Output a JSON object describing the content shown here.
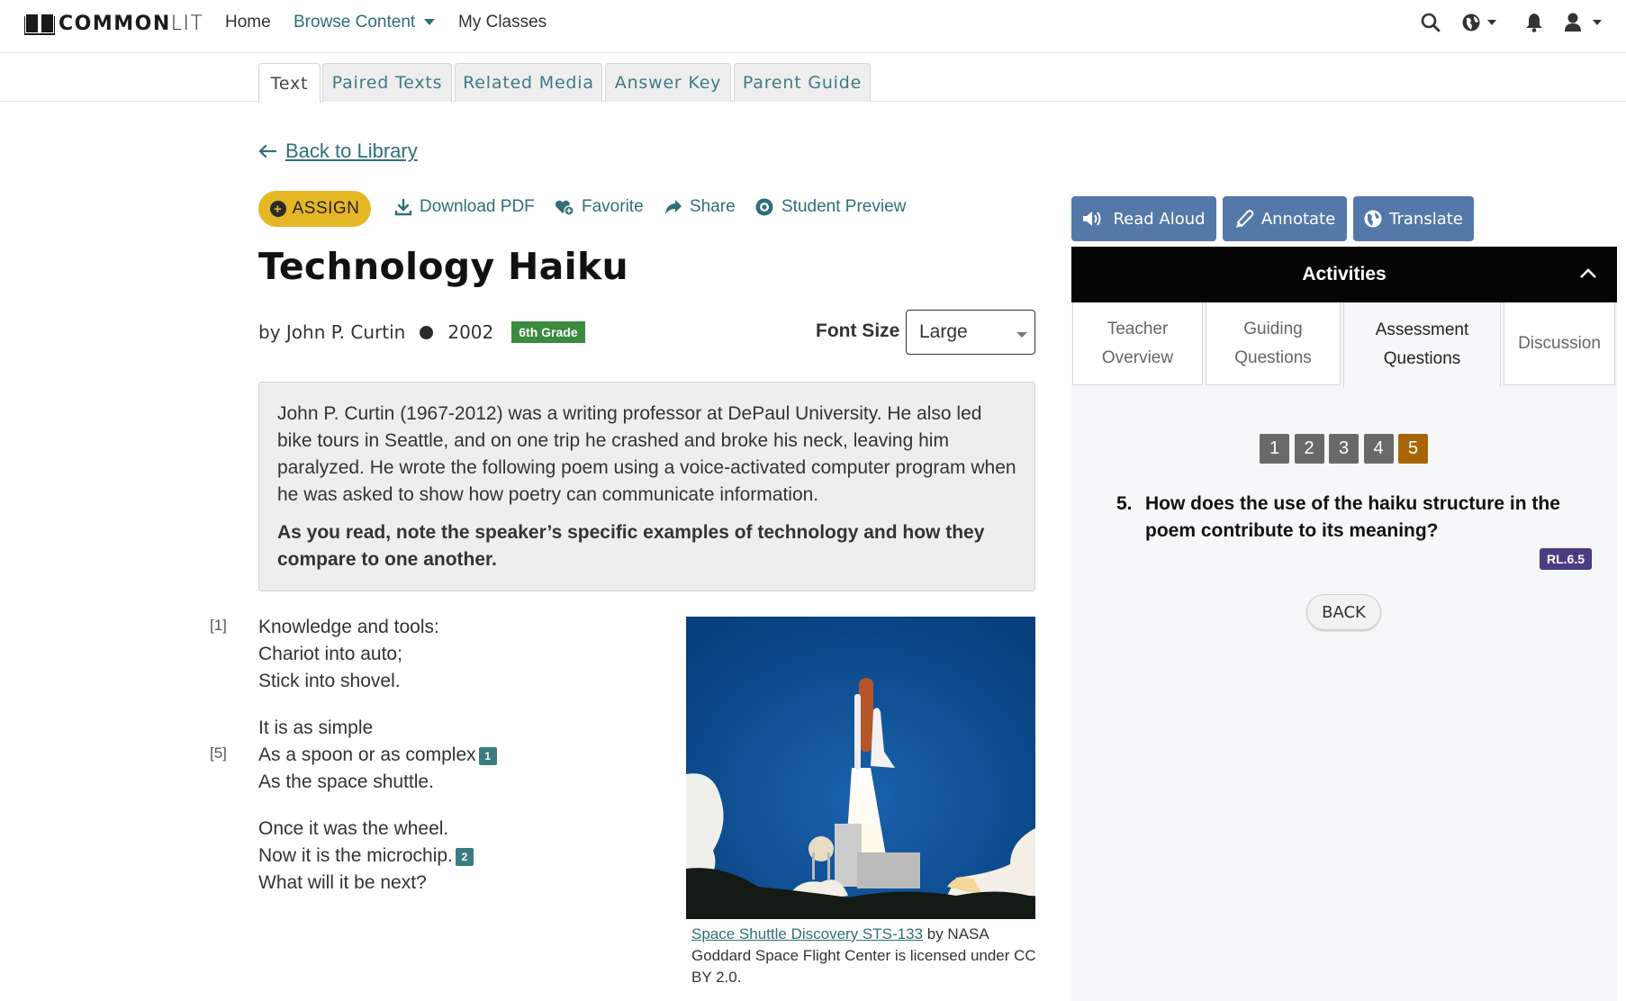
{
  "nav": {
    "logo_bold": "COMMON",
    "logo_light": "LIT",
    "links": [
      "Home",
      "Browse Content",
      "My Classes"
    ],
    "icons": [
      "search-icon",
      "globe-icon",
      "bell-icon",
      "user-icon"
    ]
  },
  "tabs": [
    "Text",
    "Paired Texts",
    "Related Media",
    "Answer Key",
    "Parent Guide"
  ],
  "active_tab": "Text",
  "back_link": "Back to Library",
  "actions": {
    "assign": "ASSIGN",
    "download": "Download PDF",
    "favorite": "Favorite",
    "share": "Share",
    "preview": "Student Preview"
  },
  "text": {
    "title": "Technology Haiku",
    "author": "by John P. Curtin",
    "year": "2002",
    "grade": "6th Grade",
    "font_size_label": "Font Size",
    "font_size_value": "Large",
    "intro": "John P. Curtin (1967-2012) was a writing professor at DePaul University. He also led bike tours in Seattle, and on one trip he crashed and broke his neck, leaving him paralyzed. He wrote the following poem using a voice-activated computer program when he was asked to show how poetry can communicate information.",
    "intro_prompt": "As you read, note the speaker’s specific examples of technology and how they compare to one another.",
    "line_numbers": [
      "[1]",
      "[5]"
    ],
    "stanzas": [
      [
        "Knowledge and tools:",
        "Chariot into auto;",
        "Stick into shovel."
      ],
      [
        "It is as simple",
        "As a spoon or as complex",
        "As the space shuttle."
      ],
      [
        "Once it was the wheel.",
        "Now it is the microchip.",
        "What will it be next?"
      ]
    ],
    "footnotes": [
      "1",
      "2"
    ],
    "caption_link": "Space Shuttle Discovery STS-133",
    "caption_rest": " by NASA Goddard Space Flight Center is licensed under CC BY 2.0."
  },
  "tools": [
    "Read Aloud",
    "Annotate",
    "Translate"
  ],
  "activities": {
    "header": "Activities",
    "tabs": [
      {
        "line1": "Teacher",
        "line2": "Overview"
      },
      {
        "line1": "Guiding",
        "line2": "Questions"
      },
      {
        "line1": "Assessment",
        "line2": "Questions"
      },
      {
        "line1": "Discussion",
        "line2": ""
      }
    ],
    "active_tab": "Assessment Questions",
    "question_numbers": [
      "1",
      "2",
      "3",
      "4",
      "5"
    ],
    "current_question": "5",
    "question_label": "5.",
    "question_text": "How does the use of the haiku structure in the poem contribute to its meaning?",
    "standard": "RL.6.5",
    "back_button": "BACK"
  },
  "colors": {
    "teal_link": "#2e6f78",
    "assign_yellow": "#e6b724",
    "tool_blue": "#5479a8",
    "grade_green": "#3b8a3d",
    "active_question": "#a86608",
    "inactive_question": "#696969",
    "standard_purple": "#4c3d82"
  }
}
